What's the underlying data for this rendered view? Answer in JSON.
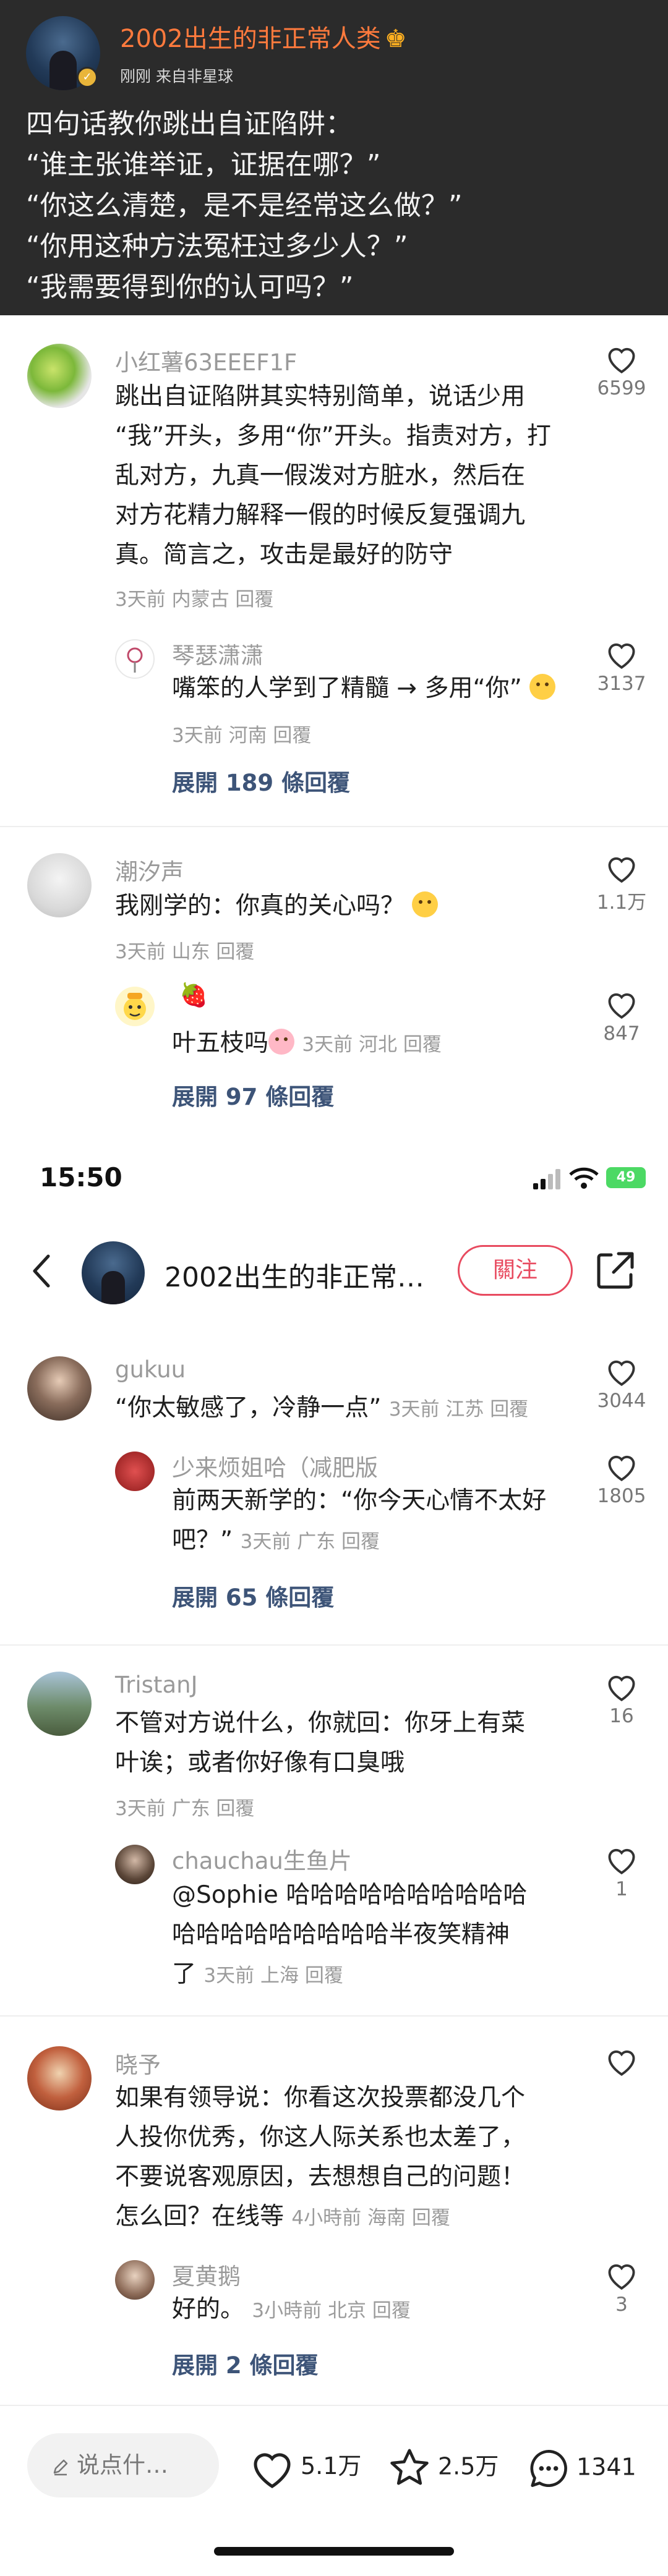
{
  "post": {
    "author": "2002出生的非正常人类",
    "crown": "♚",
    "meta": "刚刚 来自非星球",
    "lines": [
      "四句话教你跳出自证陷阱：",
      "“谁主张谁举证，证据在哪？”",
      "“你这么清楚，是不是经常这么做？”",
      "“你用这种方法冤枉过多少人？”",
      "“我需要得到你的认可吗？”"
    ]
  },
  "comments": [
    {
      "name": "小红薯63EEEF1F",
      "lines": [
        "跳出自证陷阱其实特别简单，说话少用",
        "“我”开头，多用“你”开头。指责对方，打",
        "乱对方，九真一假泼对方脏水，然后在",
        "对方花精力解释一假的时候反复强调九",
        "真。简言之，攻击是最好的防守"
      ],
      "meta": "3天前 内蒙古 回覆",
      "likes": "6599",
      "reply": {
        "name": "琴瑟潇潇",
        "text": "嘴笨的人学到了精髓 → 多用“你”",
        "meta": "3天前 河南 回覆",
        "likes": "3137"
      },
      "expand": "展開 189 條回覆"
    },
    {
      "name": "潮汐声",
      "text": "我刚学的：你真的关心吗？",
      "meta": "3天前 山东 回覆",
      "likes": "1.1万",
      "reply": {
        "name": "🍓",
        "text": "叶五枝吗",
        "meta": "3天前 河北 回覆",
        "likes": "847"
      },
      "expand": "展開 97 條回覆"
    }
  ],
  "status_bar": {
    "time": "15:50",
    "battery": "49"
  },
  "nav": {
    "back": "‹",
    "title": "2002出生的非正常…",
    "follow": "關注"
  },
  "comments2": [
    {
      "name": "gukuu",
      "text": "“你太敏感了，冷静一点”",
      "meta": "3天前 江苏 回覆",
      "likes": "3044",
      "reply": {
        "name": "少来烦姐哈（减肥版",
        "lines": [
          "前两天新学的：“你今天心情不太好",
          "吧？”"
        ],
        "meta": "3天前 广东 回覆",
        "likes": "1805"
      },
      "expand": "展開 65 條回覆"
    },
    {
      "name": "TristanJ",
      "lines": [
        "不管对方说什么，你就回：你牙上有菜",
        "叶诶；或者你好像有口臭哦"
      ],
      "meta": "3天前 广东 回覆",
      "likes": "16",
      "reply": {
        "name": "chauchau生鱼片",
        "lines": [
          "@Sophie 哈哈哈哈哈哈哈哈哈哈",
          "哈哈哈哈哈哈哈哈哈半夜笑精神",
          "了"
        ],
        "meta": "3天前 上海 回覆",
        "likes": "1"
      }
    },
    {
      "name": "晓予",
      "lines": [
        "如果有领导说：你看这次投票都没几个",
        "人投你优秀，你这人际关系也太差了，",
        "不要说客观原因，去想想自己的问题！",
        "怎么回？在线等"
      ],
      "meta": "4小時前 海南 回覆",
      "likes": "",
      "reply": {
        "name": "夏黄鹅",
        "text": "好的。",
        "meta": "3小時前 北京 回覆",
        "likes": "3"
      },
      "expand": "展開 2 條回覆"
    }
  ],
  "bottom": {
    "placeholder": "说点什…",
    "likes": "5.1万",
    "favorites": "2.5万",
    "comments": "1341"
  },
  "colors": {
    "post_bg": "#2b2b2b",
    "author": "#ff7a3d",
    "link": "#3d5478",
    "follow": "#e84a5f"
  },
  "icons": [
    "heart-icon",
    "star-icon",
    "comment-icon",
    "pen-icon",
    "back-icon",
    "share-icon",
    "wifi-icon",
    "signal-icon",
    "battery-icon"
  ]
}
